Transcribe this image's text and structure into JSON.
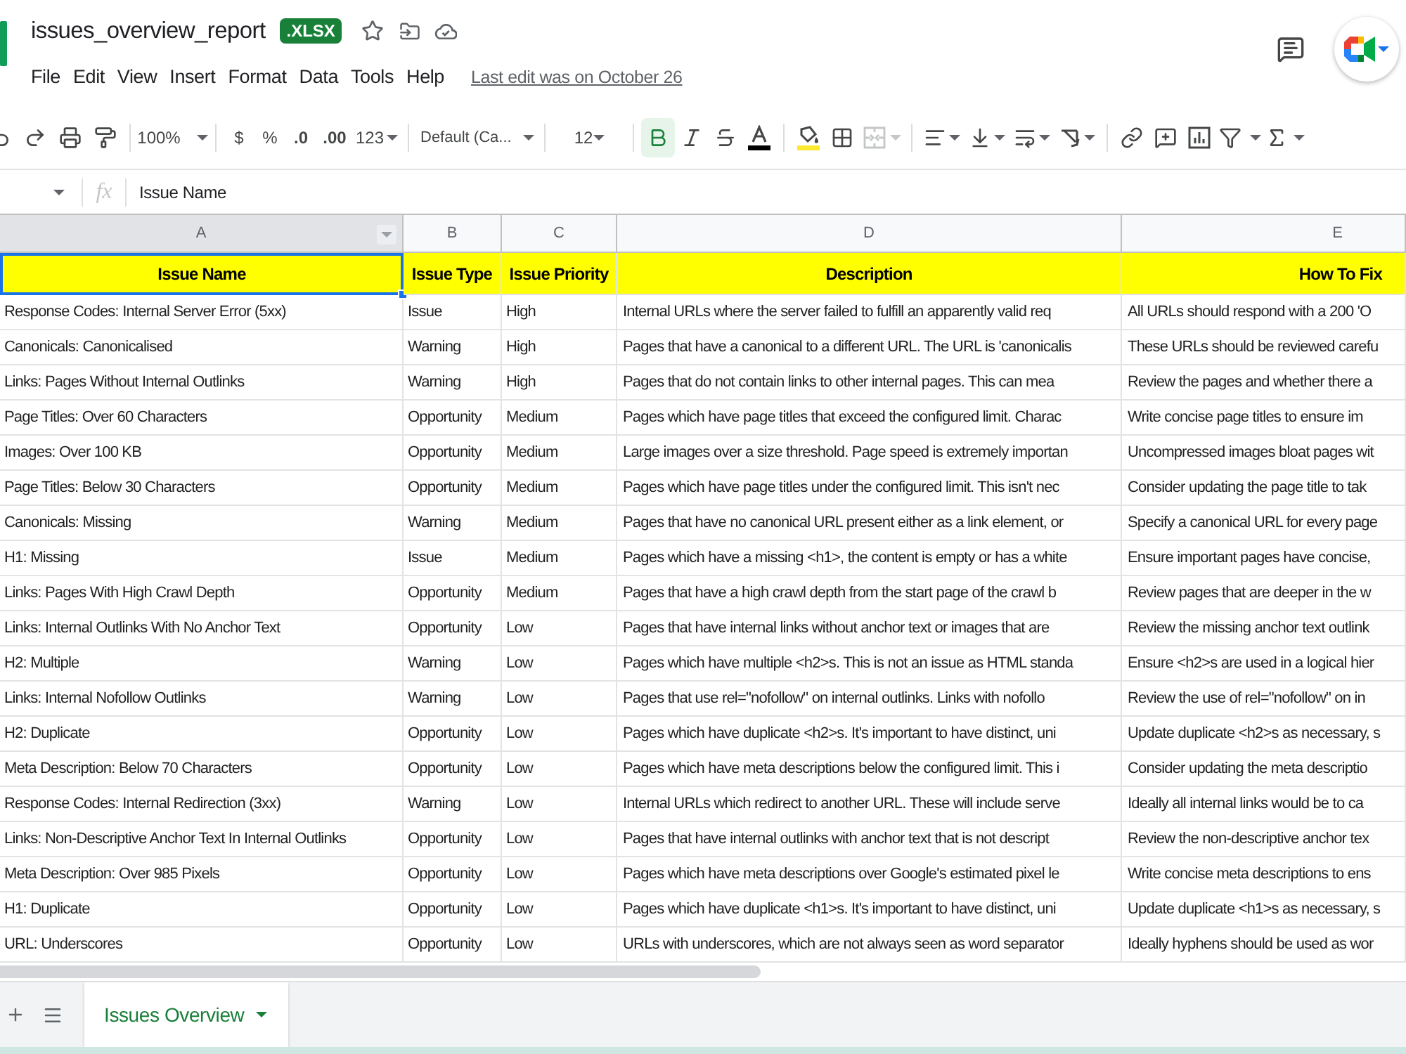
{
  "document": {
    "title": "issues_overview_report",
    "file_type": ".XLSX"
  },
  "menu": [
    "File",
    "Edit",
    "View",
    "Insert",
    "Format",
    "Data",
    "Tools",
    "Help"
  ],
  "last_edit": "Last edit was on October 26",
  "toolbar": {
    "zoom": "100%",
    "currency": "$",
    "percent": "%",
    "decrease_decimal": ".0",
    "increase_decimal": ".00",
    "number_format": "123",
    "font": "Default (Ca...",
    "font_size": "12",
    "bold_active": true,
    "merge_disabled": true
  },
  "formula_bar": {
    "function_label": "fx",
    "value": "Issue Name"
  },
  "columns": [
    {
      "letter": "A",
      "selected": true
    },
    {
      "letter": "B",
      "selected": false
    },
    {
      "letter": "C",
      "selected": false
    },
    {
      "letter": "D",
      "selected": false
    },
    {
      "letter": "E",
      "selected": false
    }
  ],
  "header_row": [
    {
      "text": "Issue Name",
      "selected": true
    },
    {
      "text": "Issue Type",
      "selected": false
    },
    {
      "text": "Issue Priority",
      "selected": false
    },
    {
      "text": "Description",
      "selected": false
    },
    {
      "text": "How To Fix",
      "selected": false
    }
  ],
  "rows": [
    [
      "Response Codes: Internal Server Error (5xx)",
      "Issue",
      "High",
      "Internal URLs where the server failed to fulfill an apparently valid req",
      "All URLs should respond with a 200 'O"
    ],
    [
      "Canonicals: Canonicalised",
      "Warning",
      "High",
      "Pages that have a canonical to a different URL. The URL is 'canonicalis",
      "These URLs should be reviewed carefu"
    ],
    [
      "Links: Pages Without Internal Outlinks",
      "Warning",
      "High",
      "Pages that do not contain links to other internal pages. This can mea",
      "Review the pages and whether there a"
    ],
    [
      "Page Titles: Over 60 Characters",
      "Opportunity",
      "Medium",
      "Pages which have page titles that exceed the configured limit. Charac",
      "Write concise page titles to ensure im"
    ],
    [
      "Images: Over 100 KB",
      "Opportunity",
      "Medium",
      "Large images over a size threshold. Page speed is extremely importan",
      "Uncompressed images bloat pages wit"
    ],
    [
      "Page Titles: Below 30 Characters",
      "Opportunity",
      "Medium",
      "Pages which have page titles under the configured limit. This isn't nec",
      "Consider updating the page title to tak"
    ],
    [
      "Canonicals: Missing",
      "Warning",
      "Medium",
      "Pages that have no canonical URL present either as a link element, or",
      "Specify a canonical URL for every page"
    ],
    [
      "H1: Missing",
      "Issue",
      "Medium",
      "Pages which have a missing <h1>, the content is empty or has a white",
      "Ensure important pages have concise,"
    ],
    [
      "Links: Pages With High Crawl Depth",
      "Opportunity",
      "Medium",
      "Pages that have a high crawl depth from the start page of the crawl b",
      "Review pages that are deeper in the w"
    ],
    [
      "Links: Internal Outlinks With No Anchor Text",
      "Opportunity",
      "Low",
      "Pages that have internal links without anchor text or images that are",
      "Review the missing anchor text outlink"
    ],
    [
      "H2: Multiple",
      "Warning",
      "Low",
      "Pages which have multiple <h2>s. This is not an issue as HTML standa",
      "Ensure <h2>s are used in a logical hier"
    ],
    [
      "Links: Internal Nofollow Outlinks",
      "Warning",
      "Low",
      "Pages that use rel=\"nofollow\" on internal outlinks. Links with nofollo",
      "Review the use of rel=\"nofollow\" on in"
    ],
    [
      "H2: Duplicate",
      "Opportunity",
      "Low",
      "Pages which have duplicate <h2>s. It's important to have distinct, uni",
      "Update duplicate <h2>s as necessary, s"
    ],
    [
      "Meta Description: Below 70 Characters",
      "Opportunity",
      "Low",
      "Pages which have meta descriptions below the configured limit. This i",
      "Consider updating the meta descriptio"
    ],
    [
      "Response Codes: Internal Redirection (3xx)",
      "Warning",
      "Low",
      "Internal URLs which redirect to another URL. These will include serve",
      "Ideally all internal links would be to ca"
    ],
    [
      "Links: Non-Descriptive Anchor Text In Internal Outlinks",
      "Opportunity",
      "Low",
      "Pages that have internal outlinks with anchor text that is not descript",
      "Review the non-descriptive anchor tex"
    ],
    [
      "Meta Description: Over 985 Pixels",
      "Opportunity",
      "Low",
      "Pages which have meta descriptions over Google's estimated pixel le",
      "Write concise meta descriptions to ens"
    ],
    [
      "H1: Duplicate",
      "Opportunity",
      "Low",
      "Pages which have duplicate <h1>s. It's important to have distinct, uni",
      "Update duplicate <h1>s as necessary, s"
    ],
    [
      "URL: Underscores",
      "Opportunity",
      "Low",
      "URLs with underscores, which are not always seen as word separator",
      "Ideally hyphens should be used as wor"
    ]
  ],
  "sheet_tabs": [
    {
      "label": "Issues Overview",
      "selected": true
    }
  ]
}
